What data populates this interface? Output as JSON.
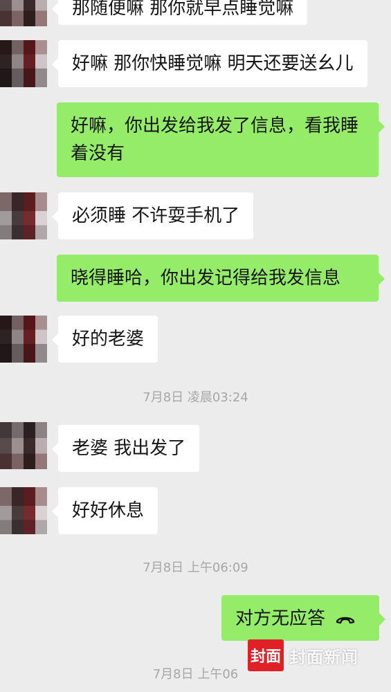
{
  "messages": [
    {
      "text": "那随便嘛 那你就早点睡觉嘛"
    },
    {
      "text": "好嘛 那你快睡觉嘛 明天还要送幺儿"
    },
    {
      "text": "好嘛，你出发给我发了信息，看我睡着没有"
    },
    {
      "text": "必须睡 不许耍手机了"
    },
    {
      "text": "晓得睡哈，你出发记得给我发信息"
    },
    {
      "text": "好的老婆"
    },
    {
      "text": "老婆 我出发了"
    },
    {
      "text": "好好休息"
    },
    {
      "text": "对方无应答"
    }
  ],
  "timestamps": [
    "7月8日 凌晨03:24",
    "7月8日 上午06:09",
    "7月8日 上午06"
  ],
  "call_icon": "phone-hangup-icon",
  "watermark": {
    "logo": "封面",
    "text": "封面新闻"
  },
  "colors": {
    "background": "#ececec",
    "incoming_bubble": "#ffffff",
    "outgoing_bubble": "#95ec69",
    "timestamp": "#a6a6a6",
    "watermark_red": "#e02027"
  }
}
